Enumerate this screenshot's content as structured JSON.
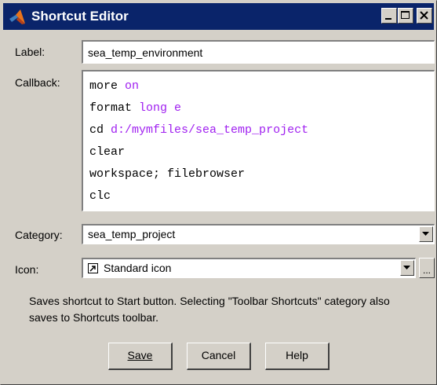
{
  "window": {
    "title": "Shortcut Editor",
    "titlebar_color": "#0a246a",
    "face_color": "#d4d0c8"
  },
  "form": {
    "label_caption": "Label:",
    "label_value": "sea_temp_environment",
    "callback_caption": "Callback:",
    "callback_lines": [
      {
        "cmd": "more",
        "arg": "on"
      },
      {
        "cmd": "format",
        "arg": "long e"
      },
      {
        "cmd": "cd",
        "arg": "d:/mymfiles/sea_temp_project"
      },
      {
        "cmd": "clear",
        "arg": ""
      },
      {
        "cmd": "workspace; filebrowser",
        "arg": ""
      },
      {
        "cmd": "clc",
        "arg": ""
      }
    ],
    "category_caption": "Category:",
    "category_value": "sea_temp_project",
    "icon_caption": "Icon:",
    "icon_value": "Standard icon",
    "browse_label": "..."
  },
  "description": "Saves shortcut to Start button. Selecting \"Toolbar Shortcuts\" category also saves to Shortcuts toolbar.",
  "buttons": {
    "save_label": "Save",
    "cancel_label": "Cancel",
    "help_label": "Help"
  },
  "colors": {
    "command": "#000000",
    "argument": "#a020f0"
  }
}
